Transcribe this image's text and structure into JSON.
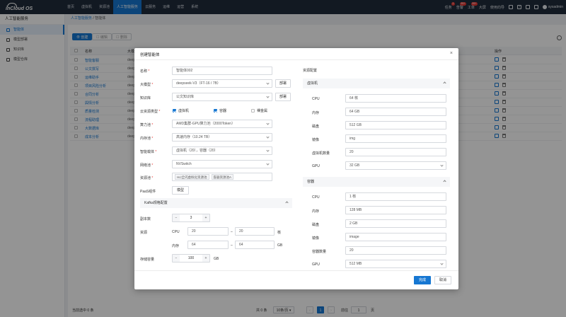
{
  "app": {
    "logo_text": "inCloud OS"
  },
  "topnav": {
    "items": [
      "首页",
      "虚拟机",
      "资源池",
      "人工智能服务",
      "云服务",
      "运维",
      "运营",
      "系统"
    ],
    "active_index": 3
  },
  "topright": {
    "task": "任务",
    "task_badge": "1",
    "alarm": "告警",
    "alarm_badge": "99+",
    "ticket": "工单",
    "ticket_badge": "99+",
    "screen": "大屏",
    "guide": "使用向导",
    "user": "sysadmin"
  },
  "sidebar": {
    "title": "人工智能服务",
    "items": [
      {
        "label": "智能体",
        "active": true
      },
      {
        "label": "模型部署",
        "active": false
      },
      {
        "label": "知识库",
        "active": false
      },
      {
        "label": "模型仓库",
        "active": false
      }
    ]
  },
  "breadcrumb": {
    "parent": "人工智能服务",
    "sep": "/",
    "current": "智能体"
  },
  "toolbar": {
    "create": "创建",
    "edit": "编辑",
    "delete": "删除"
  },
  "table": {
    "headers": {
      "name": "名称",
      "model": "大模",
      "ops": "操作"
    },
    "rows": [
      {
        "name": "智能客服",
        "model": "deep"
      },
      {
        "name": "公文撰写",
        "model": "deep"
      },
      {
        "name": "运维助手",
        "model": "deep"
      },
      {
        "name": "项目风险分析",
        "model": "deep"
      },
      {
        "name": "合同分析",
        "model": "deep"
      },
      {
        "name": "舆情分析",
        "model": "deep"
      },
      {
        "name": "质量检测",
        "model": "deep"
      },
      {
        "name": "流程助理",
        "model": "deep"
      },
      {
        "name": "大数据库",
        "model": "deep"
      },
      {
        "name": "成本分析",
        "model": "deep"
      }
    ]
  },
  "footer": {
    "selected": "当前选中 0 条",
    "total": "共 0 条",
    "page_size": "10条/页",
    "current_page": "1",
    "goto_label": "前往",
    "goto_value": "1",
    "page_unit": "页"
  },
  "modal": {
    "title": "创建智能体",
    "name_label": "名称",
    "name_value": "智能体002",
    "model_label": "大模型",
    "model_value": "deepseek-V3（FT-16 / 7B）",
    "model_btn": "部署",
    "kb_label": "知识库",
    "kb_value": "公文知识库",
    "kb_btn": "部署",
    "res_type_label": "云资源类型",
    "res_types": [
      {
        "label": "虚拟机",
        "checked": true
      },
      {
        "label": "容器",
        "checked": true
      },
      {
        "label": "裸金属",
        "checked": false
      }
    ],
    "compute_label": "算力池",
    "compute_value": "AMD集群-GPU算力池（2000Token）",
    "memory_label": "内存池",
    "memory_value": "高速内存（10.24 TB）",
    "agent_label": "智能载体",
    "agent_value": "虚拟机（20），容器（20）",
    "network_label": "网络池",
    "network_value": "NVSwitch",
    "respool_label": "资源池",
    "respool_tags": [
      "Hci全闪虚拟化资源池",
      "容器资源池A"
    ],
    "paas_label": "PaaS组件",
    "paas_btn": "模型",
    "kafka_section": "Kafka规格配置",
    "replica_label": "副本数",
    "replica_value": "3",
    "resource_label": "资源",
    "cpu_label": "CPU",
    "cpu_min": "20",
    "cpu_max": "20",
    "cpu_unit": "核",
    "mem_label": "内存",
    "mem_min": "64",
    "mem_max": "64",
    "mem_unit": "GB",
    "storage_label": "存储容量",
    "storage_value": "100",
    "storage_unit": "GB",
    "right_title": "资源配置",
    "vm_section": "虚拟机",
    "vm_fields": [
      {
        "label": "CPU",
        "value": "64 核"
      },
      {
        "label": "内存",
        "value": "64 GB"
      },
      {
        "label": "磁盘",
        "value": "512 GB"
      },
      {
        "label": "镜像",
        "value": "img"
      },
      {
        "label": "虚拟机数量",
        "value": "20"
      },
      {
        "label": "GPU",
        "value": "32 GB"
      }
    ],
    "ct_section": "容器",
    "ct_fields": [
      {
        "label": "CPU",
        "value": "1 核"
      },
      {
        "label": "内存",
        "value": "128 MB"
      },
      {
        "label": "磁盘",
        "value": "2 GB"
      },
      {
        "label": "镜像",
        "value": "image"
      },
      {
        "label": "容器数量",
        "value": "20"
      },
      {
        "label": "GPU",
        "value": "512 MB"
      }
    ],
    "ok": "完成",
    "cancel": "取消"
  },
  "colors": {
    "primary": "#1677d2",
    "topbar": "#1f2b3b"
  }
}
